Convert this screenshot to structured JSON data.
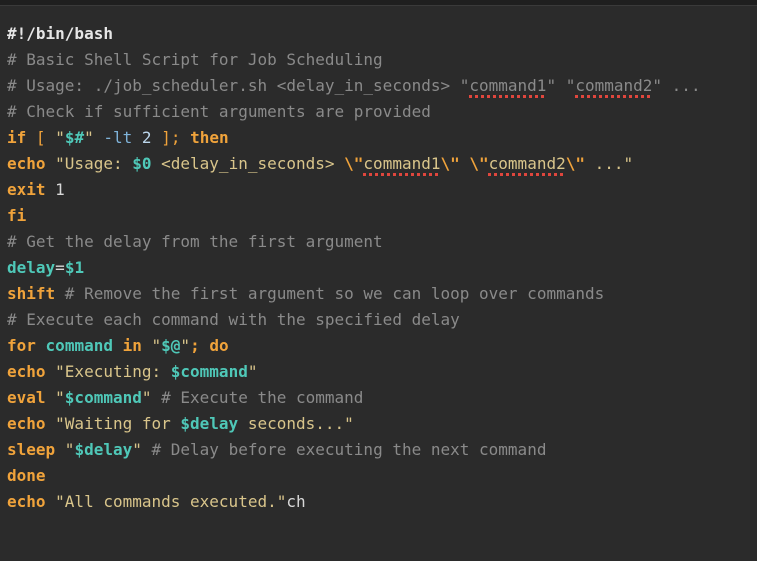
{
  "editor": {
    "lines": [
      [
        {
          "t": "#!/bin/bash",
          "c": "shebang"
        }
      ],
      [
        {
          "t": "# Basic Shell Script for Job Scheduling",
          "c": "comment"
        }
      ],
      [
        {
          "t": "# Usage: ./job_scheduler.sh <delay_in_seconds> \"",
          "c": "comment"
        },
        {
          "t": "command1",
          "c": "comment",
          "sq": true
        },
        {
          "t": "\" \"",
          "c": "comment"
        },
        {
          "t": "command2",
          "c": "comment",
          "sq": true
        },
        {
          "t": "\" ...",
          "c": "comment"
        }
      ],
      [
        {
          "t": "# Check if sufficient arguments are provided",
          "c": "comment"
        }
      ],
      [
        {
          "t": "if",
          "c": "kw"
        },
        {
          "t": " ",
          "c": "plain"
        },
        {
          "t": "[",
          "c": "bracket"
        },
        {
          "t": " ",
          "c": "plain"
        },
        {
          "t": "\"",
          "c": "str"
        },
        {
          "t": "$#",
          "c": "var"
        },
        {
          "t": "\"",
          "c": "str"
        },
        {
          "t": " ",
          "c": "plain"
        },
        {
          "t": "-lt",
          "c": "op"
        },
        {
          "t": " ",
          "c": "plain"
        },
        {
          "t": "2",
          "c": "num"
        },
        {
          "t": " ",
          "c": "plain"
        },
        {
          "t": "];",
          "c": "bracket"
        },
        {
          "t": " ",
          "c": "plain"
        },
        {
          "t": "then",
          "c": "kw"
        }
      ],
      [
        {
          "t": "echo",
          "c": "kw"
        },
        {
          "t": " \"Usage: ",
          "c": "str"
        },
        {
          "t": "$0",
          "c": "var"
        },
        {
          "t": " <delay_in_seconds> ",
          "c": "str"
        },
        {
          "t": "\\\"",
          "c": "kw"
        },
        {
          "t": "command1",
          "c": "str",
          "sq": true
        },
        {
          "t": "\\\"",
          "c": "kw"
        },
        {
          "t": " ",
          "c": "str"
        },
        {
          "t": "\\\"",
          "c": "kw"
        },
        {
          "t": "command2",
          "c": "str",
          "sq": true
        },
        {
          "t": "\\\"",
          "c": "kw"
        },
        {
          "t": " ...\"",
          "c": "str"
        }
      ],
      [
        {
          "t": "exit",
          "c": "kw"
        },
        {
          "t": " 1",
          "c": "plain"
        }
      ],
      [
        {
          "t": "fi",
          "c": "kw"
        }
      ],
      [
        {
          "t": "# Get the delay from the first argument",
          "c": "comment"
        }
      ],
      [
        {
          "t": "delay",
          "c": "var"
        },
        {
          "t": "=",
          "c": "plain"
        },
        {
          "t": "$1",
          "c": "var"
        }
      ],
      [
        {
          "t": "shift",
          "c": "kw"
        },
        {
          "t": " # Remove the first argument so we can loop over commands",
          "c": "comment"
        }
      ],
      [
        {
          "t": "# Execute each command with the specified delay",
          "c": "comment"
        }
      ],
      [
        {
          "t": "for",
          "c": "kw"
        },
        {
          "t": " ",
          "c": "plain"
        },
        {
          "t": "command",
          "c": "var"
        },
        {
          "t": " ",
          "c": "plain"
        },
        {
          "t": "in",
          "c": "kw"
        },
        {
          "t": " \"",
          "c": "str"
        },
        {
          "t": "$@",
          "c": "var"
        },
        {
          "t": "\"",
          "c": "str"
        },
        {
          "t": ";",
          "c": "kw"
        },
        {
          "t": " ",
          "c": "plain"
        },
        {
          "t": "do",
          "c": "kw"
        }
      ],
      [
        {
          "t": "echo",
          "c": "kw"
        },
        {
          "t": " \"Executing: ",
          "c": "str"
        },
        {
          "t": "$command",
          "c": "var"
        },
        {
          "t": "\"",
          "c": "str"
        }
      ],
      [
        {
          "t": "eval",
          "c": "kw"
        },
        {
          "t": " \"",
          "c": "str"
        },
        {
          "t": "$command",
          "c": "var"
        },
        {
          "t": "\"",
          "c": "str"
        },
        {
          "t": " # Execute the command",
          "c": "comment"
        }
      ],
      [
        {
          "t": "echo",
          "c": "kw"
        },
        {
          "t": " \"Waiting for ",
          "c": "str"
        },
        {
          "t": "$delay",
          "c": "var"
        },
        {
          "t": " seconds...\"",
          "c": "str"
        }
      ],
      [
        {
          "t": "sleep",
          "c": "kw"
        },
        {
          "t": " \"",
          "c": "str"
        },
        {
          "t": "$delay",
          "c": "var"
        },
        {
          "t": "\"",
          "c": "str"
        },
        {
          "t": " # Delay before executing the next command",
          "c": "comment"
        }
      ],
      [
        {
          "t": "done",
          "c": "kw"
        }
      ],
      [
        {
          "t": "echo",
          "c": "kw"
        },
        {
          "t": " \"All commands executed.\"",
          "c": "str"
        },
        {
          "t": "ch",
          "c": "plain"
        }
      ]
    ]
  }
}
